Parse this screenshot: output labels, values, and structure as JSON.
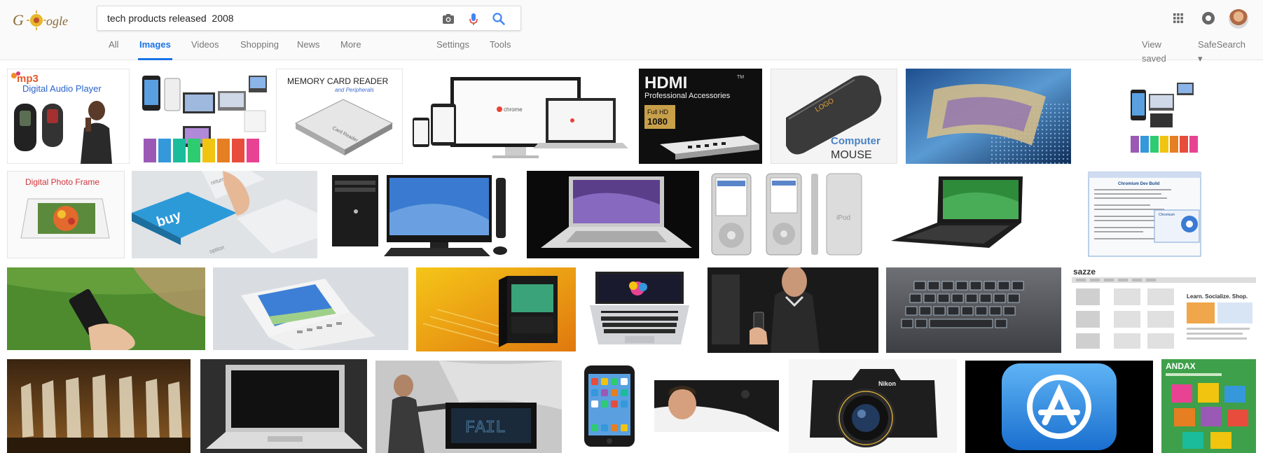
{
  "search": {
    "query": "tech products released  2008",
    "icons": [
      "camera-icon",
      "microphone-icon",
      "search-icon"
    ]
  },
  "tabs": [
    {
      "label": "All"
    },
    {
      "label": "Images",
      "active": true
    },
    {
      "label": "Videos"
    },
    {
      "label": "Shopping"
    },
    {
      "label": "News"
    },
    {
      "label": "More"
    },
    {
      "label": "Settings"
    },
    {
      "label": "Tools"
    }
  ],
  "header_right": {
    "view_saved": "View saved",
    "safesearch": "SafeSearch ▾",
    "icons": [
      "apps-grid-icon",
      "notifications-icon",
      "avatar"
    ]
  },
  "colors": {
    "accent": "#1a73e8",
    "tab_text": "#777777"
  },
  "thumbnails": {
    "mp3": {
      "brand": "mp3",
      "caption": "Digital Audio Player"
    },
    "card_reader": {
      "title": "MEMORY CARD READER",
      "subtitle": "and Peripherals",
      "device_text": "Card Reader"
    },
    "chrome": {
      "brand": "chrome"
    },
    "hdmi": {
      "brand": "HDMI",
      "tm": "TM",
      "caption": "Professional Accessories",
      "badge_top": "Full HD",
      "badge_bottom": "1080"
    },
    "mouse": {
      "logo": "LOGO",
      "caption_1": "Computer",
      "caption_2": "MOUSE"
    },
    "photo_frame": {
      "caption": "Digital Photo Frame"
    },
    "keyboard_buy": {
      "key_label": "buy",
      "other_keys": [
        "return",
        "option"
      ]
    },
    "ipod": {
      "label": "iPod"
    },
    "chromium": {
      "window_title": "Chromium Dev Build",
      "badge": "Chromium"
    },
    "sazze": {
      "brand": "sazze",
      "tagline": "Learn. Socialize. Shop."
    },
    "fail_monitor": {
      "text": "FAIL"
    },
    "nikon": {
      "brand": "Nikon"
    },
    "andax": {
      "brand": "ANDAX"
    }
  }
}
